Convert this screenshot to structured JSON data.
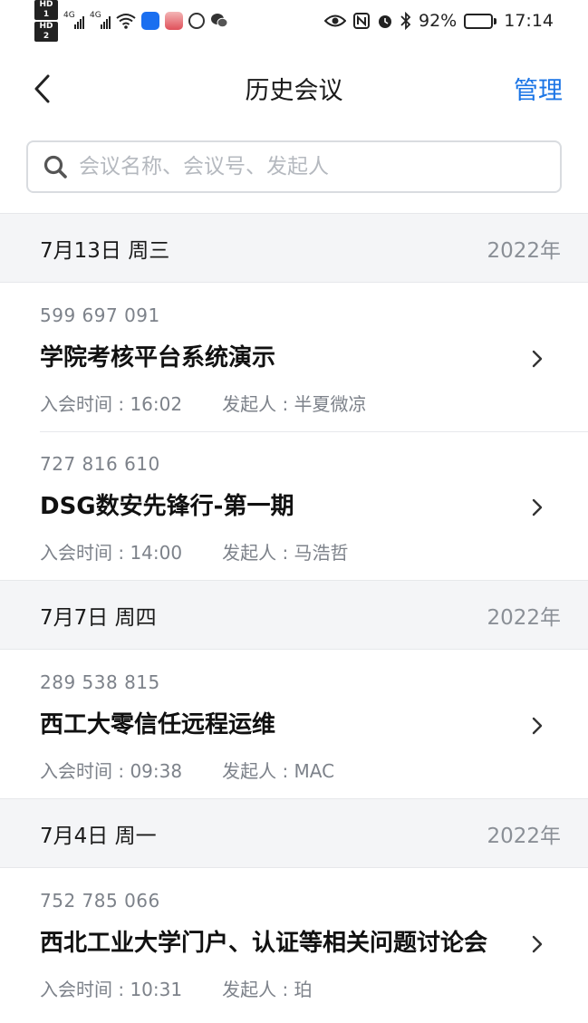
{
  "status_bar": {
    "hd1": "HD 1",
    "hd2": "HD 2",
    "net1": "4G",
    "net2": "4G",
    "battery_percent": "92%",
    "battery_level": 0.92,
    "time": "17:14"
  },
  "nav": {
    "title": "历史会议",
    "manage_label": "管理"
  },
  "search": {
    "placeholder": "会议名称、会议号、发起人",
    "value": ""
  },
  "groups": [
    {
      "date": "7月13日 周三",
      "year": "2022年",
      "meetings": [
        {
          "id": "599 697 091",
          "title": "学院考核平台系统演示",
          "join_time": "入会时间 : 16:02",
          "host": "发起人 : 半夏微凉"
        },
        {
          "id": "727 816 610",
          "title": "DSG数安先锋行-第一期",
          "join_time": "入会时间 : 14:00",
          "host": "发起人 : 马浩哲"
        }
      ]
    },
    {
      "date": "7月7日 周四",
      "year": "2022年",
      "meetings": [
        {
          "id": "289 538 815",
          "title": "西工大零信任远程运维",
          "join_time": "入会时间 : 09:38",
          "host": "发起人 : MAC"
        }
      ]
    },
    {
      "date": "7月4日 周一",
      "year": "2022年",
      "meetings": [
        {
          "id": "752 785 066",
          "title": "西北工业大学门户、认证等相关问题讨论会",
          "join_time": "入会时间 : 10:31",
          "host": "发起人 : 珀"
        }
      ]
    }
  ],
  "colors": {
    "accent": "#1b75e6",
    "header_bg": "#f4f5f7",
    "secondary_text": "#7d828a"
  }
}
